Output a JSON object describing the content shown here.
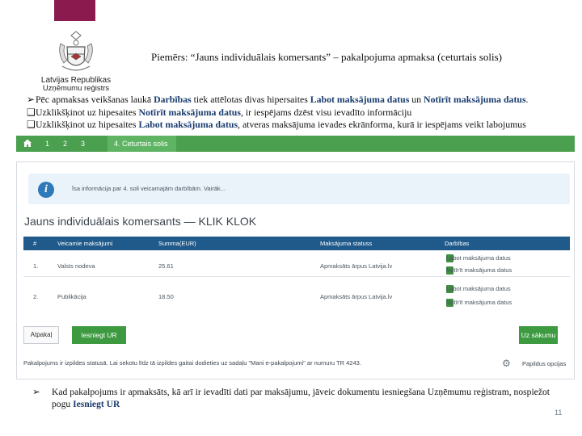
{
  "logo": {
    "line1": "Latvijas Republikas",
    "line2": "Uzņēmumu reģistrs"
  },
  "slide_title": "Piemērs: “Jauns individuālais komersants” – pakalpojuma apmaksa (ceturtais solis)",
  "bullets": [
    {
      "marker": "➢",
      "parts": [
        "Pēc apmaksas veikšanas laukā ",
        "Darbības",
        " tiek attēlotas divas hipersaites ",
        "Labot maksājuma datus",
        " un ",
        "Notīrīt maksājuma datus",
        "."
      ]
    },
    {
      "marker": "❑",
      "parts": [
        "Uzklikšķinot uz hipesaites ",
        "Notīrīt maksājuma datus",
        ", ir iespējams dzēst visu ievadīto informāciju"
      ]
    },
    {
      "marker": "❑",
      "parts": [
        "Uzklikšķinot uz hipesaites ",
        "Labot maksājuma datus",
        ", atveras maksājuma ievades ekrānforma, kurā ir iespējams veikt labojumus"
      ]
    }
  ],
  "screenshot": {
    "nav": {
      "home_icon": "home-icon",
      "steps": [
        "1",
        "2",
        "3"
      ],
      "active_step": "4. Ceturtais solis"
    },
    "info": {
      "icon": "info-icon",
      "text": "Īsa informācija par 4. soli veicamajām darbībām. Vairāk..."
    },
    "title": "Jauns individuālais komersants — KLIK KLOK",
    "table": {
      "headers": [
        "#",
        "Veicamie maksājumi",
        "Summa(EUR)",
        "Maksājuma statuss",
        "Darbības"
      ],
      "rows": [
        {
          "num": "1.",
          "name": "Valsts nodeva",
          "sum": "25.61",
          "status": "Apmaksāts ārpus Latvija.lv",
          "actions": [
            "Labot maksājuma datus",
            "Notīrīt maksājuma datus"
          ]
        },
        {
          "num": "2.",
          "name": "Publikācija",
          "sum": "18.50",
          "status": "Apmaksāts ārpus Latvija.lv",
          "actions": [
            "Labot maksājuma datus",
            "Notīrīt maksājuma datus"
          ]
        }
      ]
    },
    "buttons": {
      "back": "Atpakaļ",
      "submit": "Iesniegt UR",
      "start": "Uz sākumu"
    },
    "footnote": "Pakalpojums ir izpildes statusā. Lai sekotu līdz tā izpildes gaitai dodieties uz sadaļu \"Mani e-pakalpojumi\" ar numuru TR 4243.",
    "extra_options": "Papildus opcijas",
    "gear_icon": "gear-icon"
  },
  "bottom": {
    "marker": "➢",
    "parts": [
      "Kad pakalpojums ir apmaksāts, kā arī ir ievadīti dati par maksājumu, jāveic dokumentu iesniegšana Uzņēmumu reģistram, nospiežot pogu ",
      "Iesniegt UR"
    ]
  },
  "page_number": "11",
  "colors": {
    "top_bar": "#8b1a4e",
    "nav_green": "#4aa04e",
    "table_header": "#1f5a8b",
    "button_green": "#3d9a41",
    "hyperlink_text": "#1a3c6e"
  }
}
